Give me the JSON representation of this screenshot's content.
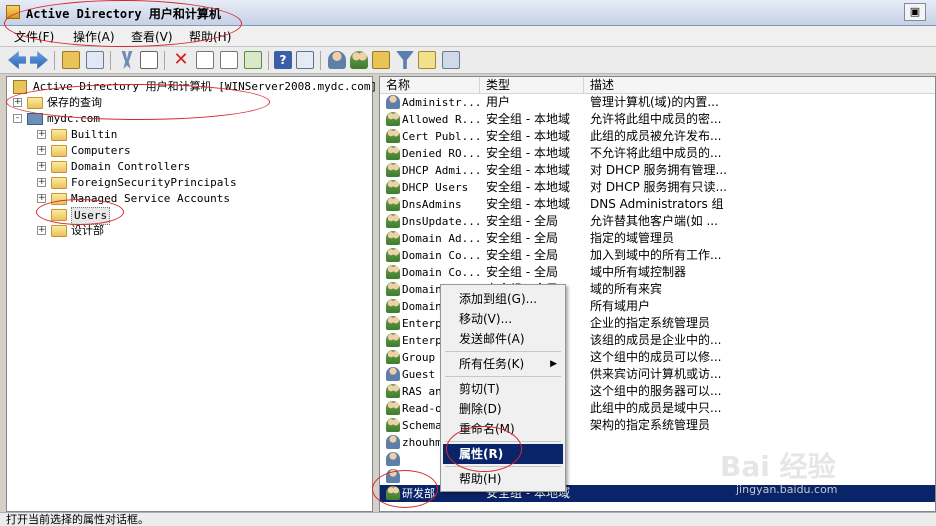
{
  "window": {
    "title": "Active Directory 用户和计算机"
  },
  "menu": [
    "文件(F)",
    "操作(A)",
    "查看(V)",
    "帮助(H)"
  ],
  "tree": {
    "root": "Active Directory 用户和计算机 [WINServer2008.mydc.com]",
    "items": [
      {
        "label": "保存的查询",
        "indent": 0,
        "expander": "+",
        "icon": "folder-icon"
      },
      {
        "label": "mydc.com",
        "indent": 0,
        "expander": "-",
        "icon": "domain-icon"
      },
      {
        "label": "Builtin",
        "indent": 1,
        "expander": "+",
        "icon": "folder-icon"
      },
      {
        "label": "Computers",
        "indent": 1,
        "expander": "+",
        "icon": "folder-icon"
      },
      {
        "label": "Domain Controllers",
        "indent": 1,
        "expander": "+",
        "icon": "folder-icon"
      },
      {
        "label": "ForeignSecurityPrincipals",
        "indent": 1,
        "expander": "+",
        "icon": "folder-icon"
      },
      {
        "label": "Managed Service Accounts",
        "indent": 1,
        "expander": "+",
        "icon": "folder-icon"
      },
      {
        "label": "Users",
        "indent": 1,
        "expander": "",
        "icon": "folder-icon",
        "selected": true
      },
      {
        "label": "设计部",
        "indent": 1,
        "expander": "+",
        "icon": "folder-icon"
      }
    ]
  },
  "list": {
    "columns": [
      "名称",
      "类型",
      "描述"
    ],
    "rows": [
      {
        "name": "Administr...",
        "type": "用户",
        "desc": "管理计算机(域)的内置...",
        "kind": "user"
      },
      {
        "name": "Allowed R...",
        "type": "安全组 - 本地域",
        "desc": "允许将此组中成员的密...",
        "kind": "group"
      },
      {
        "name": "Cert Publ...",
        "type": "安全组 - 本地域",
        "desc": "此组的成员被允许发布...",
        "kind": "group"
      },
      {
        "name": "Denied RO...",
        "type": "安全组 - 本地域",
        "desc": "不允许将此组中成员的...",
        "kind": "group"
      },
      {
        "name": "DHCP Admi...",
        "type": "安全组 - 本地域",
        "desc": "对 DHCP 服务拥有管理...",
        "kind": "group"
      },
      {
        "name": "DHCP Users",
        "type": "安全组 - 本地域",
        "desc": "对 DHCP 服务拥有只读...",
        "kind": "group"
      },
      {
        "name": "DnsAdmins",
        "type": "安全组 - 本地域",
        "desc": "DNS Administrators 组",
        "kind": "group"
      },
      {
        "name": "DnsUpdate...",
        "type": "安全组 - 全局",
        "desc": "允许替其他客户端(如 ...",
        "kind": "group"
      },
      {
        "name": "Domain Ad...",
        "type": "安全组 - 全局",
        "desc": "指定的域管理员",
        "kind": "group"
      },
      {
        "name": "Domain Co...",
        "type": "安全组 - 全局",
        "desc": "加入到域中的所有工作...",
        "kind": "group"
      },
      {
        "name": "Domain Co...",
        "type": "安全组 - 全局",
        "desc": "域中所有域控制器",
        "kind": "group"
      },
      {
        "name": "Domain G...",
        "type": "安全组 - 全局",
        "desc": "域的所有来宾",
        "kind": "group"
      },
      {
        "name": "Domain ...",
        "type": "",
        "desc": "所有域用户",
        "kind": "group"
      },
      {
        "name": "Enterp...",
        "type": "",
        "desc": "企业的指定系统管理员",
        "kind": "group"
      },
      {
        "name": "Enterp...",
        "type": "",
        "desc": "该组的成员是企业中的...",
        "kind": "group"
      },
      {
        "name": "Group ...",
        "type": "",
        "desc": "这个组中的成员可以修...",
        "kind": "group"
      },
      {
        "name": "Guest",
        "type": "",
        "desc": "供来宾访问计算机或访...",
        "kind": "user"
      },
      {
        "name": "RAS an...",
        "type": "",
        "desc": "这个组中的服务器可以...",
        "kind": "group"
      },
      {
        "name": "Read-o...",
        "type": "",
        "desc": "此组中的成员是域中只...",
        "kind": "group"
      },
      {
        "name": "Schema...",
        "type": "",
        "desc": "架构的指定系统管理员",
        "kind": "group"
      },
      {
        "name": "zhouhm",
        "type": "",
        "desc": "",
        "kind": "user"
      },
      {
        "name": "",
        "type": "",
        "desc": "",
        "kind": "user"
      },
      {
        "name": "",
        "type": "",
        "desc": "",
        "kind": "user"
      },
      {
        "name": "研发部",
        "type": "安全组 - 本地域",
        "desc": "",
        "kind": "group",
        "selected": true
      }
    ]
  },
  "context_menu": {
    "items": [
      {
        "label": "添加到组(G)...",
        "sep_after": false
      },
      {
        "label": "移动(V)...",
        "sep_after": false
      },
      {
        "label": "发送邮件(A)",
        "sep_after": true
      },
      {
        "label": "所有任务(K)",
        "submenu": true,
        "sep_after": true
      },
      {
        "label": "剪切(T)",
        "sep_after": false
      },
      {
        "label": "删除(D)",
        "sep_after": false
      },
      {
        "label": "重命名(M)",
        "sep_after": true
      },
      {
        "label": "属性(R)",
        "active": true,
        "sep_after": true
      },
      {
        "label": "帮助(H)",
        "sep_after": false
      }
    ]
  },
  "status": "打开当前选择的属性对话框。",
  "watermark": {
    "brand": "Bai 经验",
    "url": "jingyan.baidu.com"
  }
}
